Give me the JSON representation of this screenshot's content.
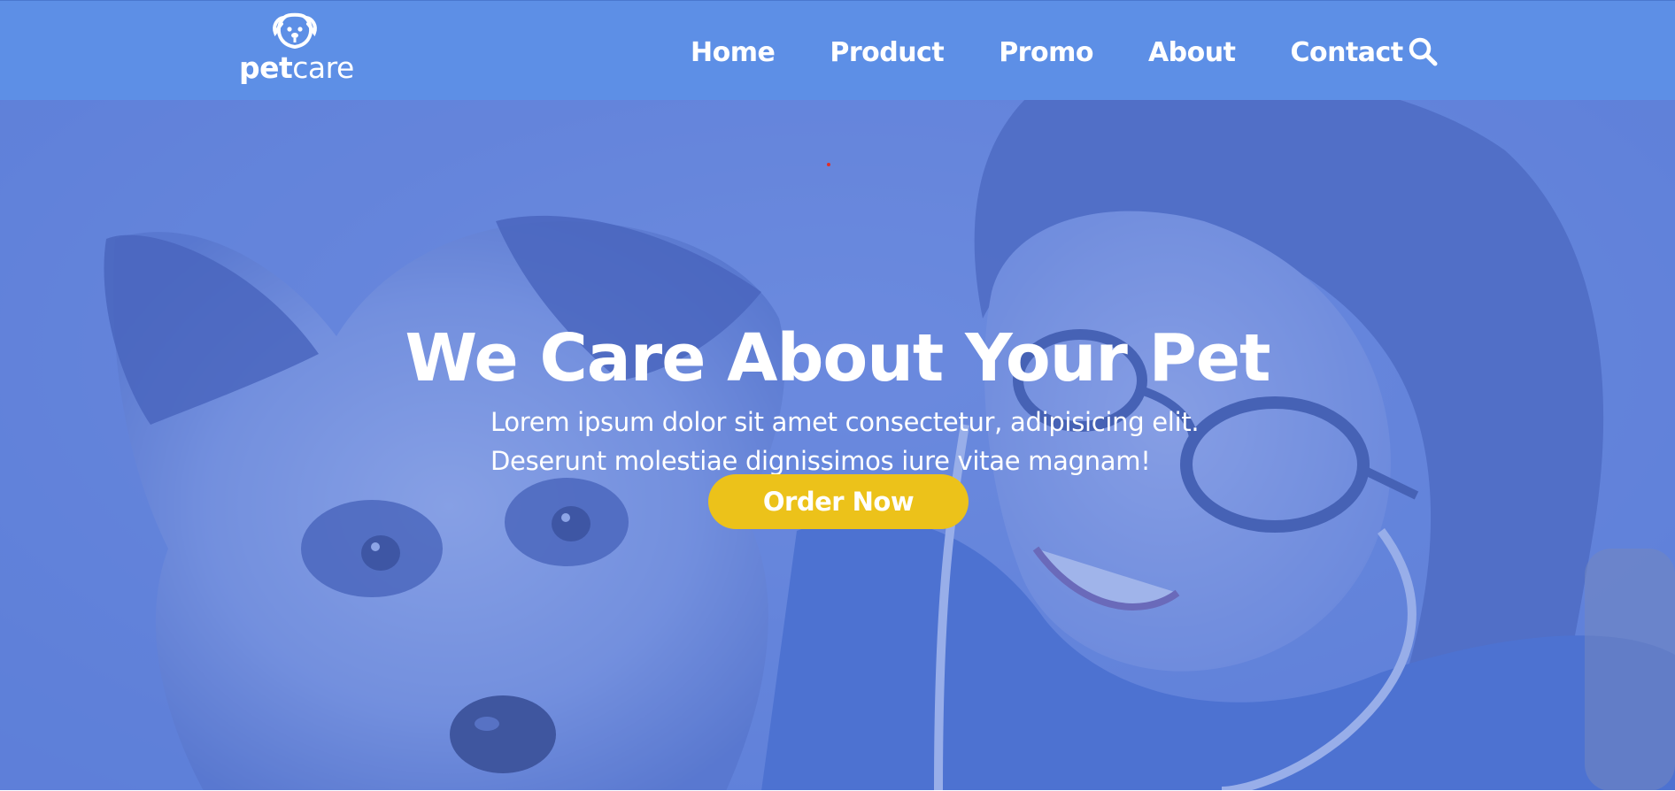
{
  "brand": {
    "logo_bold": "pet",
    "logo_light": "care",
    "logo_icon": "dog-head-icon"
  },
  "nav": {
    "items": [
      {
        "label": "Home"
      },
      {
        "label": "Product"
      },
      {
        "label": "Promo"
      },
      {
        "label": "About"
      },
      {
        "label": "Contact"
      }
    ],
    "search_icon": "search-icon"
  },
  "hero": {
    "title": "We Care About Your Pet",
    "subtitle_line1": "Lorem ipsum dolor sit amet consectetur, adipisicing elit.",
    "subtitle_line2": "Deserunt molestiae dignissimos iure vitae magnam!",
    "cta_label": "Order Now",
    "background_image": "vet-with-dog-photo"
  },
  "colors": {
    "nav_bg": "#5d8fe6",
    "hero_tint": "#5c80dc",
    "cta_bg": "#ecc21a",
    "text": "#ffffff"
  }
}
